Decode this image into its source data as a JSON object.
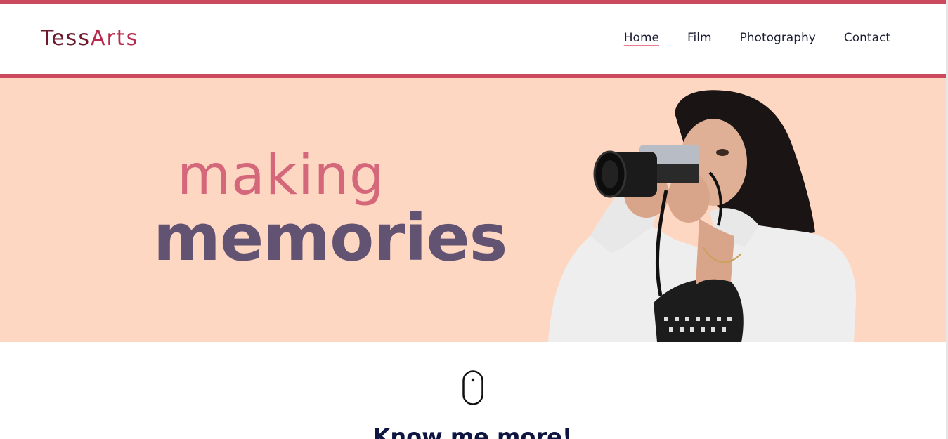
{
  "brand": {
    "name_part1": "Tess",
    "name_part2": "Arts"
  },
  "nav": {
    "items": [
      {
        "label": "Home",
        "active": true
      },
      {
        "label": "Film",
        "active": false
      },
      {
        "label": "Photography",
        "active": false
      },
      {
        "label": "Contact",
        "active": false
      }
    ]
  },
  "hero": {
    "line1": "making",
    "line2": "memories",
    "image_subject": "woman-with-camera"
  },
  "scroll_section": {
    "icon": "mouse-icon",
    "heading": "Know me more!"
  },
  "colors": {
    "accent_stripe": "#cc4a5e",
    "hero_bg": "#fed7c2",
    "making_text": "#d4677a",
    "memories_text": "#635373",
    "heading_text": "#0d1540",
    "nav_underline": "#e87a92"
  }
}
